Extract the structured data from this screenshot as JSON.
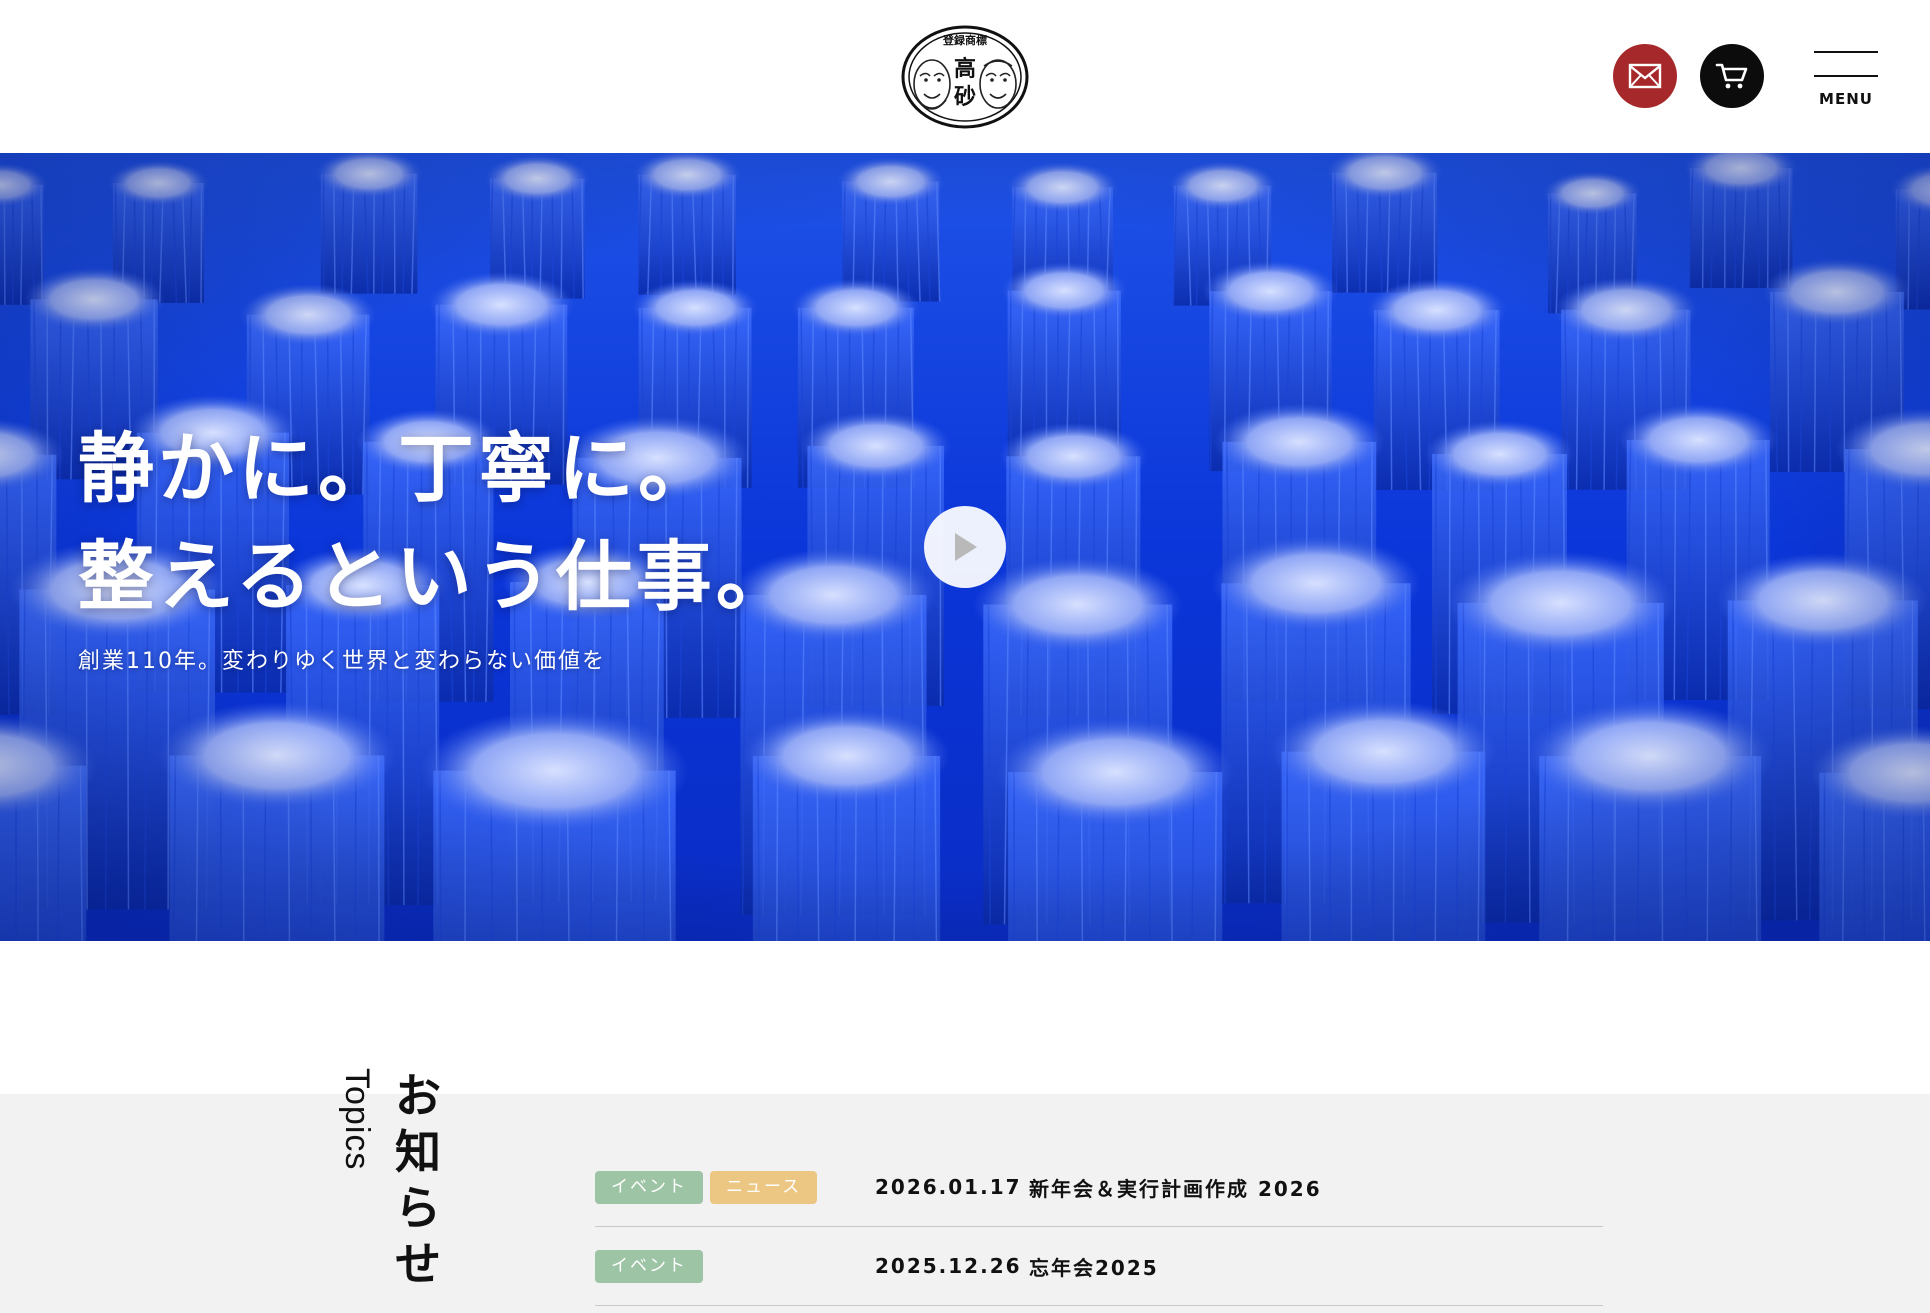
{
  "header": {
    "logo_alt": "登録商標 高砂",
    "mail_icon": "mail-icon",
    "cart_icon": "cart-icon",
    "menu_label": "MENU"
  },
  "hero": {
    "title_line1": "静かに。丁寧に。",
    "title_line2": "整えるという仕事。",
    "subtitle": "創業110年。変わりゆく世界と変わらない価値を",
    "play_icon": "play-icon"
  },
  "topics": {
    "heading_en": "Topics",
    "heading_jp": "お知らせ",
    "items": [
      {
        "tags": [
          "イベント",
          "ニュース"
        ],
        "date": "2026.01.17",
        "title": "新年会＆実行計画作成 2026"
      },
      {
        "tags": [
          "イベント"
        ],
        "date": "2025.12.26",
        "title": "忘年会2025"
      }
    ]
  },
  "colors": {
    "mail_button": "#a7282b",
    "cart_button": "#0c0c0c",
    "tag_event": "#9dc4a4",
    "tag_news": "#ecc784",
    "hero_blue": "#0a2fd6",
    "topics_bg": "#f2f2f2"
  }
}
